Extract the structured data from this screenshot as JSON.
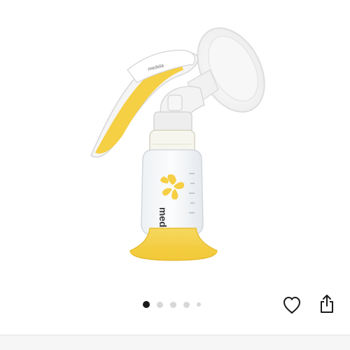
{
  "gallery": {
    "brand_text": "medela",
    "handle_text": "medela",
    "dots_total": 5,
    "active_index": 0
  },
  "actions": {
    "favorite_icon": "heart-outline-icon",
    "share_icon": "share-icon"
  },
  "colors": {
    "brand_yellow": "#f5cf44",
    "dot_active": "#1a1a1a",
    "dot_inactive": "#d7d7d7"
  }
}
